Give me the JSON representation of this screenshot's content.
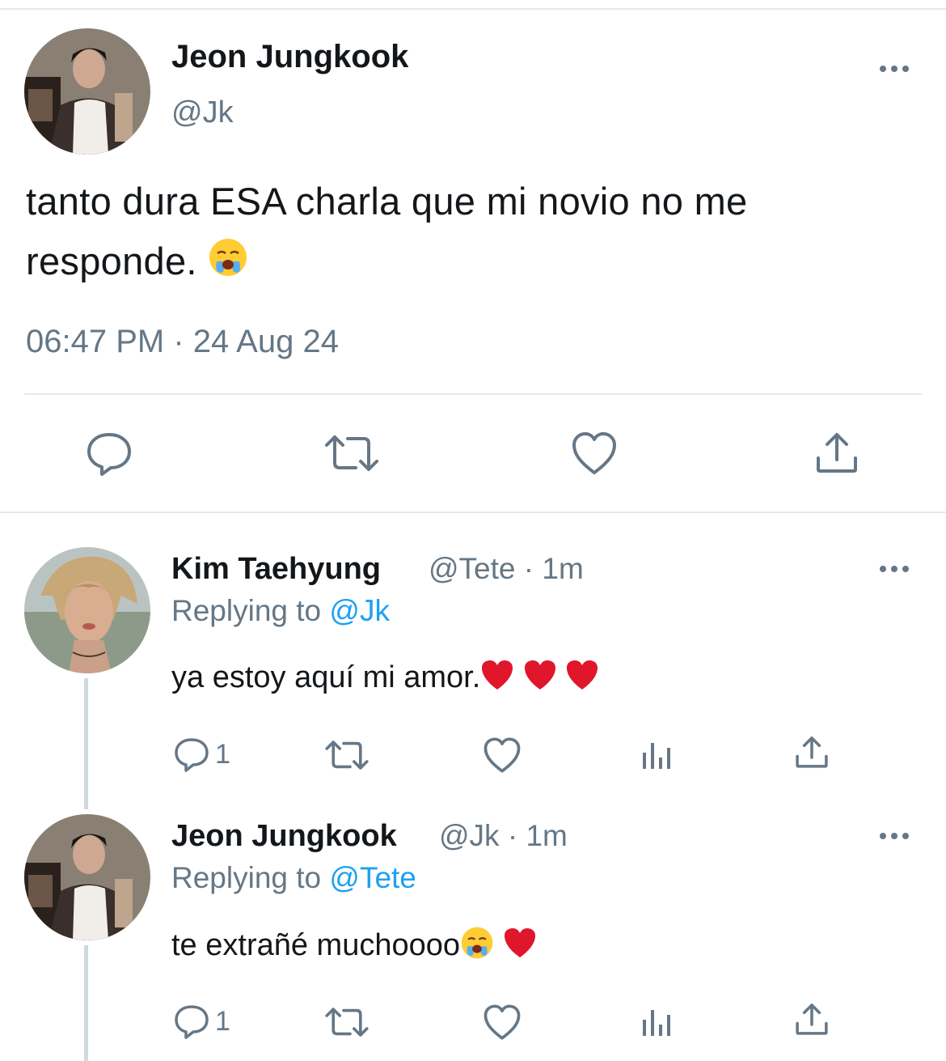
{
  "main_tweet": {
    "author_name": "Jeon Jungkook",
    "author_handle": "@Jk",
    "text": "tanto dura ESA charla que mi novio no me responde.",
    "timestamp": "06:47 PM · 24 Aug 24",
    "emoji": "crying-face"
  },
  "replies": [
    {
      "author_name": "Kim Taehyung",
      "author_handle": "@Tete",
      "time": "· 1m",
      "replying_label": "Replying to",
      "replying_to": "@Jk",
      "text": "ya estoy aquí mi amor.",
      "emojis": [
        "red-heart",
        "red-heart",
        "red-heart"
      ],
      "reply_count": "1"
    },
    {
      "author_name": "Jeon Jungkook",
      "author_handle": "@Jk",
      "time": "· 1m",
      "replying_label": "Replying to",
      "replying_to": "@Tete",
      "text": "te extrañé muchoooo",
      "emojis": [
        "crying-face",
        "red-heart"
      ],
      "reply_count": "1"
    }
  ],
  "colors": {
    "text": "#14171a",
    "secondary": "#657786",
    "link": "#1da1f2",
    "divider": "#e6e9ec",
    "heart_emoji": "#e0162b"
  }
}
